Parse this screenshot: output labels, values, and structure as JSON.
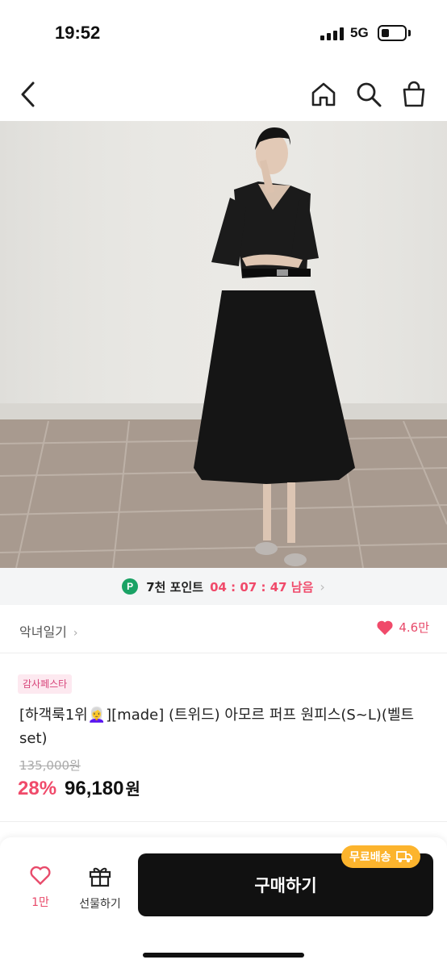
{
  "status_bar": {
    "time": "19:52",
    "network": "5G"
  },
  "hero": {
    "image_count": 5,
    "active_index": 0
  },
  "points": {
    "badge": "P",
    "label": "7천 포인트",
    "timer": "04 : 07 : 47 남음",
    "chevron": "›"
  },
  "store": {
    "name": "악녀일기",
    "chevron": "›",
    "likes": "4.6만"
  },
  "product": {
    "tag": "감사페스타",
    "title": "[하객룩1위👩‍🦳][made] (트위드) 아모르 퍼프 원피스(S~L)(벨트set)",
    "original_price": "135,000원",
    "discount": "28%",
    "price": "96,180",
    "currency": "원"
  },
  "bottom_bar": {
    "like_count": "1만",
    "gift_label": "선물하기",
    "buy_label": "구매하기",
    "free_shipping": "무료배송"
  },
  "colors": {
    "accent_pink": "#f04a6a",
    "points_green": "#1aa265",
    "free_ship_yellow": "#fcb42d",
    "buy_button": "#111111"
  },
  "icons": [
    "back-icon",
    "home-icon",
    "search-icon",
    "shopping-bag-icon",
    "expand-icon",
    "heart-icon",
    "gift-icon",
    "truck-icon"
  ]
}
